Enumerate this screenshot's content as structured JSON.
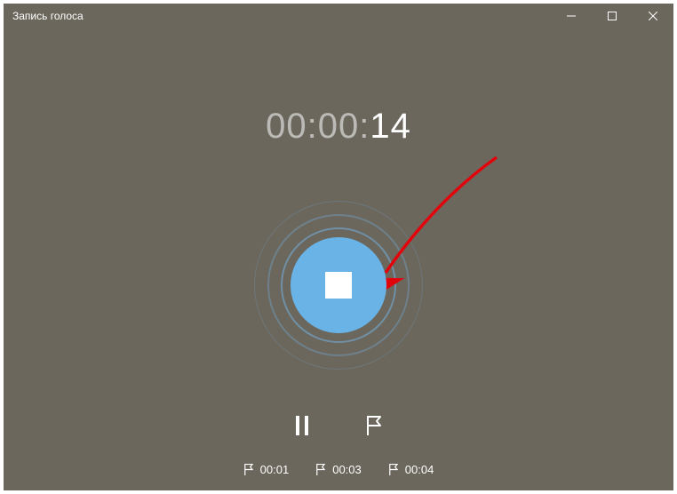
{
  "window": {
    "title": "Запись голоса"
  },
  "timer": {
    "dim": "00:00:",
    "active": "14"
  },
  "colors": {
    "accent": "#69B3E7",
    "arrow": "#E2040B"
  },
  "markers": [
    {
      "time": "00:01"
    },
    {
      "time": "00:03"
    },
    {
      "time": "00:04"
    }
  ]
}
